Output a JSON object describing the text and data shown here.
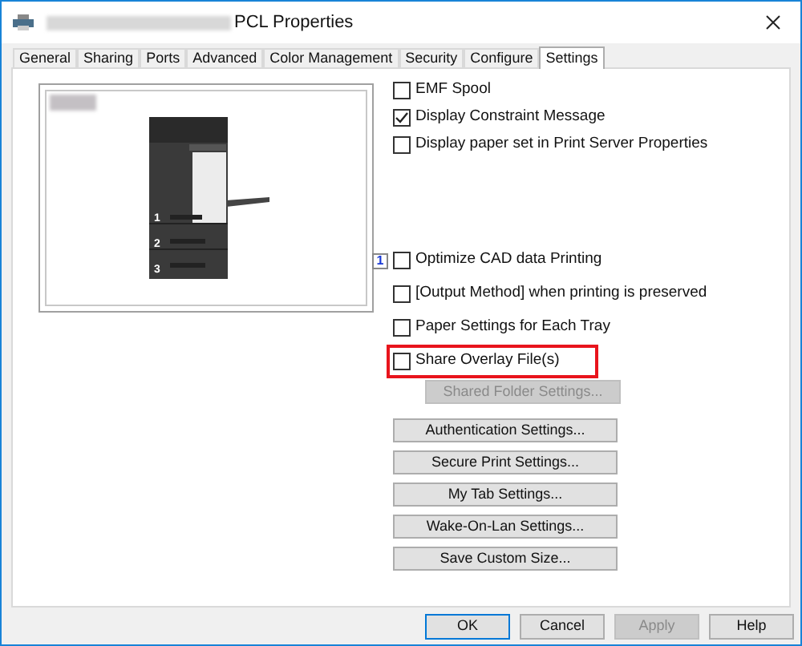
{
  "window": {
    "title": "PCL Properties"
  },
  "tabs": [
    {
      "label": "General",
      "selected": false
    },
    {
      "label": "Sharing",
      "selected": false
    },
    {
      "label": "Ports",
      "selected": false
    },
    {
      "label": "Advanced",
      "selected": false
    },
    {
      "label": "Color Management",
      "selected": false
    },
    {
      "label": "Security",
      "selected": false
    },
    {
      "label": "Configure",
      "selected": false
    },
    {
      "label": "Settings",
      "selected": true
    }
  ],
  "preview": {
    "trays": [
      "1",
      "2",
      "3"
    ]
  },
  "options_top": [
    {
      "label": "EMF Spool",
      "checked": false
    },
    {
      "label": "Display Constraint Message",
      "checked": true
    },
    {
      "label": "Display paper set in Print Server Properties",
      "checked": false
    }
  ],
  "options_bottom": [
    {
      "label": "Optimize CAD data Printing",
      "checked": false,
      "highlighted": false,
      "badge": "1"
    },
    {
      "label": "[Output Method] when printing is preserved",
      "checked": false,
      "highlighted": false
    },
    {
      "label": "Paper Settings for Each Tray",
      "checked": false,
      "highlighted": false
    },
    {
      "label": "Share Overlay File(s)",
      "checked": false,
      "highlighted": true
    }
  ],
  "shared_folder_button": {
    "label": "Shared Folder Settings...",
    "disabled": true
  },
  "settings_buttons": [
    {
      "label": "Authentication Settings...",
      "disabled": false
    },
    {
      "label": "Secure Print Settings...",
      "disabled": false
    },
    {
      "label": "My Tab Settings...",
      "disabled": false
    },
    {
      "label": "Wake-On-Lan Settings...",
      "disabled": false
    },
    {
      "label": "Save Custom Size...",
      "disabled": false
    }
  ],
  "dialog_buttons": [
    {
      "label": "OK",
      "disabled": false,
      "default": true
    },
    {
      "label": "Cancel",
      "disabled": false,
      "default": false
    },
    {
      "label": "Apply",
      "disabled": true,
      "default": false
    },
    {
      "label": "Help",
      "disabled": false,
      "default": false
    }
  ]
}
